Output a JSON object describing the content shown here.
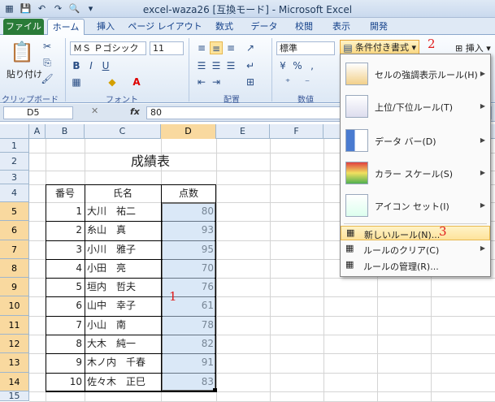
{
  "window": {
    "title": "excel-waza26 [互換モード] - Microsoft Excel"
  },
  "tabs": [
    "ファイル",
    "ホーム",
    "挿入",
    "ページ レイアウト",
    "数式",
    "データ",
    "校閲",
    "表示",
    "開発"
  ],
  "ribbon": {
    "paste_label": "貼り付け",
    "font_name": "ＭＳ Ｐゴシック",
    "font_size": "11",
    "number_format": "標準",
    "conditional_format": "条件付き書式",
    "insert": "挿入",
    "groups": {
      "clipboard": "クリップボード",
      "font": "フォント",
      "alignment": "配置",
      "number": "数値"
    }
  },
  "formula_bar": {
    "name_box": "D5",
    "fx": "fx",
    "value": "80"
  },
  "columns": [
    "A",
    "B",
    "C",
    "D",
    "E",
    "F"
  ],
  "selected_column": "D",
  "rows": [
    "1",
    "2",
    "3",
    "4",
    "5",
    "6",
    "7",
    "8",
    "9",
    "10",
    "11",
    "12",
    "13",
    "14",
    "15"
  ],
  "selected_rows": [
    "5",
    "6",
    "7",
    "8",
    "9",
    "10",
    "11",
    "12",
    "13",
    "14"
  ],
  "sheet": {
    "title": "成績表",
    "headers": {
      "no": "番号",
      "name": "氏名",
      "score": "点数"
    },
    "records": [
      {
        "no": "1",
        "name": "大川　祐二",
        "score": "80"
      },
      {
        "no": "2",
        "name": "糸山　真",
        "score": "93"
      },
      {
        "no": "3",
        "name": "小川　雅子",
        "score": "95"
      },
      {
        "no": "4",
        "name": "小田　亮",
        "score": "70"
      },
      {
        "no": "5",
        "name": "垣内　哲夫",
        "score": "76"
      },
      {
        "no": "6",
        "name": "山中　幸子",
        "score": "61"
      },
      {
        "no": "7",
        "name": "小山　南",
        "score": "78"
      },
      {
        "no": "8",
        "name": "大木　純一",
        "score": "82"
      },
      {
        "no": "9",
        "name": "木ノ内　千春",
        "score": "91"
      },
      {
        "no": "10",
        "name": "佐々木　正巳",
        "score": "83"
      }
    ]
  },
  "menu": {
    "highlight_rules": "セルの強調表示ルール(H)",
    "top_bottom_rules": "上位/下位ルール(T)",
    "data_bars": "データ バー(D)",
    "color_scales": "カラー スケール(S)",
    "icon_sets": "アイコン セット(I)",
    "new_rule": "新しいルール(N)...",
    "clear_rules": "ルールのクリア(C)",
    "manage_rules": "ルールの管理(R)..."
  },
  "annotations": {
    "step1": "1",
    "step2": "2",
    "step3": "3"
  },
  "colors": {
    "selection": "#bcd6f2",
    "header_selected": "#f9d99f",
    "file_tab": "#2a7b38",
    "annotation": "#e01b1b"
  }
}
